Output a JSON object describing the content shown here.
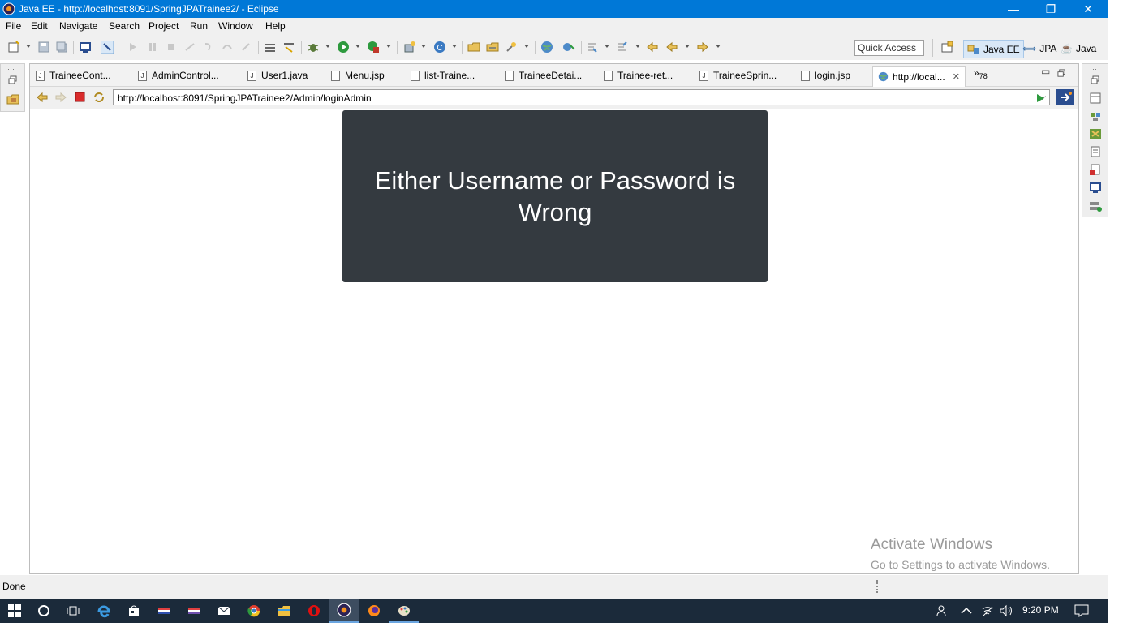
{
  "window": {
    "title": "Java EE - http://localhost:8091/SpringJPATrainee2/ - Eclipse",
    "minimize": "—",
    "restore": "❐",
    "close": "✕"
  },
  "menu": [
    "File",
    "Edit",
    "Navigate",
    "Search",
    "Project",
    "Run",
    "Window",
    "Help"
  ],
  "toolbar": {
    "quick_access": "Quick Access",
    "perspectives": [
      "Java EE",
      "JPA",
      "Java"
    ]
  },
  "tabs": [
    {
      "label": "TraineeCont...",
      "icon": "java-file-icon"
    },
    {
      "label": "AdminControl...",
      "icon": "java-file-icon"
    },
    {
      "label": "User1.java",
      "icon": "java-file-icon"
    },
    {
      "label": "Menu.jsp",
      "icon": "jsp-file-icon"
    },
    {
      "label": "list-Traine...",
      "icon": "jsp-file-icon"
    },
    {
      "label": "TraineeDetai...",
      "icon": "jsp-file-icon"
    },
    {
      "label": "Trainee-ret...",
      "icon": "jsp-file-icon"
    },
    {
      "label": "TraineeSprin...",
      "icon": "java-file-icon"
    },
    {
      "label": "login.jsp",
      "icon": "jsp-file-icon"
    },
    {
      "label": "http://local...",
      "icon": "globe-icon",
      "active": true
    }
  ],
  "overflow": {
    "chevron": "»",
    "count": "78"
  },
  "browser": {
    "url": "http://localhost:8091/SpringJPATrainee2/Admin/loginAdmin"
  },
  "page": {
    "message": "Either Username or Password is Wrong"
  },
  "watermark": {
    "line1": "Activate Windows",
    "line2": "Go to Settings to activate Windows."
  },
  "status": {
    "text": "Done"
  },
  "taskbar": {
    "time": "9:20 PM"
  },
  "colors": {
    "titlebar": "#0078d7",
    "error_box": "#343a40",
    "taskbar": "#1b2a3a"
  }
}
